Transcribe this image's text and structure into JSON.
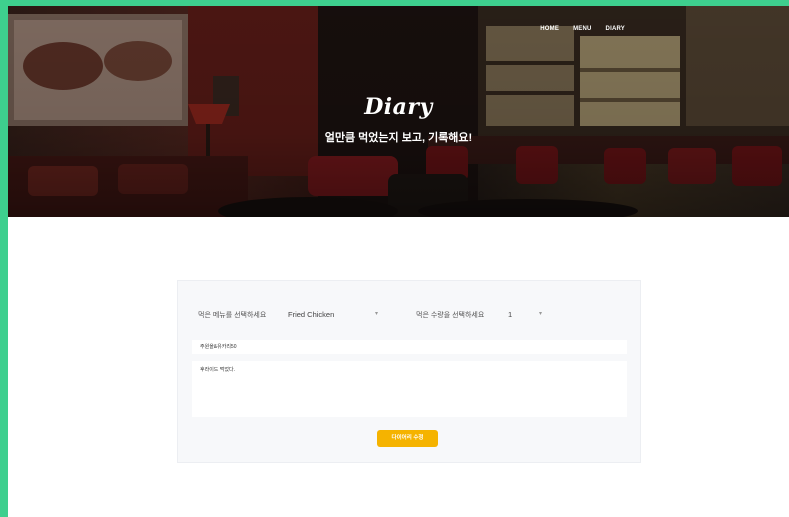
{
  "nav": {
    "items": [
      "HOME",
      "MENU",
      "DIARY"
    ]
  },
  "hero": {
    "title": "Diary",
    "subtitle": "얼만큼 먹었는지 보고, 기록해요!"
  },
  "form": {
    "menu_label": "먹은 메뉴를 선택하세요",
    "menu_value": "Fried Chicken",
    "quantity_label": "먹은 수량을 선택하세요",
    "quantity_value": "1",
    "title_value": "주원을&유카리50",
    "body_value": "후라이드 먹었다.",
    "submit_label": "다이어리 수정"
  },
  "colors": {
    "frame": "#3ecf8e",
    "accent": "#f5b300",
    "card_bg": "#f7f8fa"
  }
}
